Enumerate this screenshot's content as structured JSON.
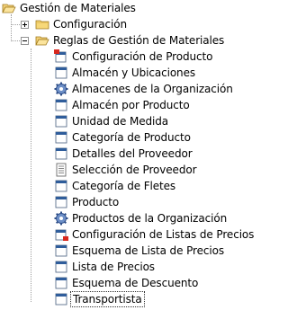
{
  "tree": {
    "root": {
      "label": "Gestión de Materiales",
      "icon": "folder-open-icon",
      "expanded": true
    },
    "children": [
      {
        "label": "Configuración",
        "icon": "folder-closed-icon",
        "expanded": false
      },
      {
        "label": "Reglas de Gestión de Materiales",
        "icon": "folder-open-icon",
        "expanded": true,
        "items": [
          {
            "label": "Configuración de Producto",
            "icon": "window-red-icon"
          },
          {
            "label": "Almacén y Ubicaciones",
            "icon": "window-icon"
          },
          {
            "label": "Almacenes de la Organización",
            "icon": "gear-icon"
          },
          {
            "label": "Almacén por Producto",
            "icon": "window-icon"
          },
          {
            "label": "Unidad de Medida",
            "icon": "window-icon"
          },
          {
            "label": "Categoría de Producto",
            "icon": "window-icon"
          },
          {
            "label": "Detalles del Proveedor",
            "icon": "window-icon"
          },
          {
            "label": "Selección de Proveedor",
            "icon": "report-icon"
          },
          {
            "label": "Categoría de Fletes",
            "icon": "window-icon"
          },
          {
            "label": "Producto",
            "icon": "window-icon"
          },
          {
            "label": "Productos de la Organización",
            "icon": "gear-icon"
          },
          {
            "label": "Configuración de Listas de Precios",
            "icon": "window-red-icon"
          },
          {
            "label": "Esquema de Lista de Precios",
            "icon": "window-icon"
          },
          {
            "label": "Lista de Precios",
            "icon": "window-icon"
          },
          {
            "label": "Esquema de Descuento",
            "icon": "window-icon"
          },
          {
            "label": "Transportista",
            "icon": "window-icon",
            "selected": true
          }
        ]
      }
    ]
  }
}
